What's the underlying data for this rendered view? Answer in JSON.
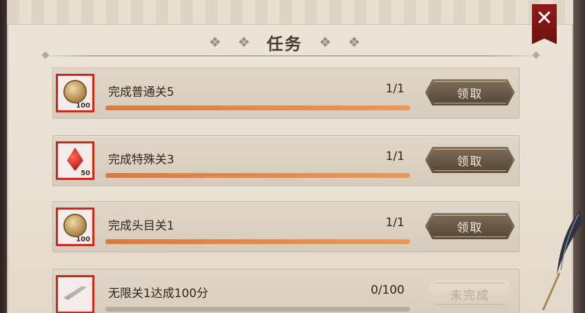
{
  "title": "任务",
  "close_label": "✕",
  "tasks": [
    {
      "name": "完成普通关5",
      "progress": "1/1",
      "fill": 1.0,
      "reward_icon": "coin",
      "reward_qty": "100",
      "button": "领取",
      "enabled": true
    },
    {
      "name": "完成特殊关3",
      "progress": "1/1",
      "fill": 1.0,
      "reward_icon": "red-gem",
      "reward_qty": "50",
      "button": "领取",
      "enabled": true
    },
    {
      "name": "完成头目关1",
      "progress": "1/1",
      "fill": 1.0,
      "reward_icon": "coin",
      "reward_qty": "100",
      "button": "领取",
      "enabled": true
    },
    {
      "name": "无限关1达成100分",
      "progress": "0/100",
      "fill": 0.0,
      "reward_icon": "sword",
      "reward_qty": "",
      "button": "未完成",
      "enabled": false
    }
  ],
  "colors": {
    "close_bg": "#8f1a19",
    "progress_fill": "#e4773a",
    "claim_bg": "#6b5b49",
    "icon_border": "#c62b1e"
  }
}
